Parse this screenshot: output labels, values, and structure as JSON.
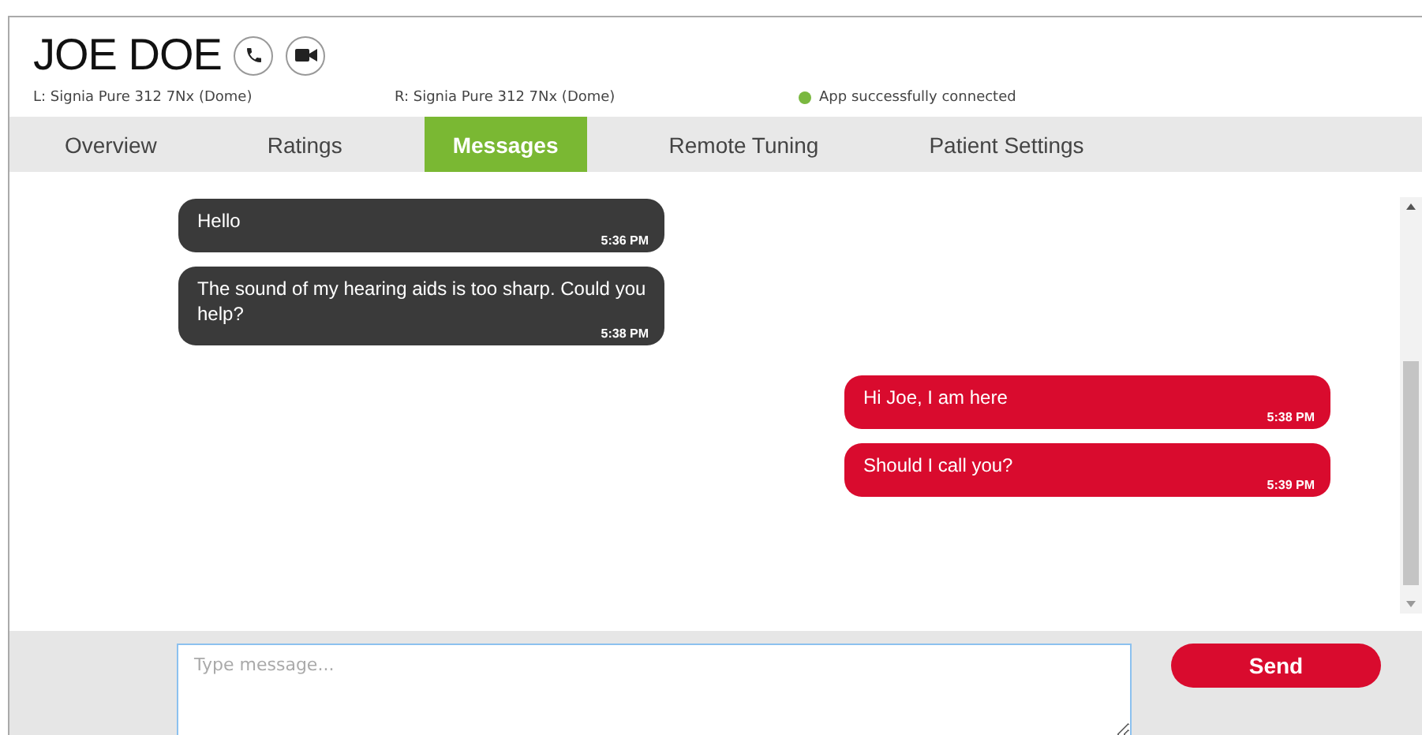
{
  "patient": {
    "name": "JOE DOE",
    "left_device": "L: Signia Pure 312 7Nx (Dome)",
    "right_device": "R: Signia Pure 312 7Nx (Dome)",
    "status": "App successfully connected"
  },
  "tabs": [
    {
      "label": "Overview",
      "selected": false
    },
    {
      "label": "Ratings",
      "selected": false
    },
    {
      "label": "Messages",
      "selected": true
    },
    {
      "label": "Remote Tuning",
      "selected": false
    },
    {
      "label": "Patient Settings",
      "selected": false
    }
  ],
  "messages": [
    {
      "kind": "incoming",
      "text": "Hello",
      "time": "5:36 PM"
    },
    {
      "kind": "incoming",
      "text": "The sound of my hearing aids is too sharp. Could you help?",
      "time": "5:38 PM"
    },
    {
      "kind": "outgoing",
      "text": "Hi Joe, I am here",
      "time": "5:38 PM"
    },
    {
      "kind": "outgoing",
      "text": "Should I call you?",
      "time": "5:39 PM"
    }
  ],
  "composer": {
    "placeholder": "Type message...",
    "send_label": "Send"
  }
}
